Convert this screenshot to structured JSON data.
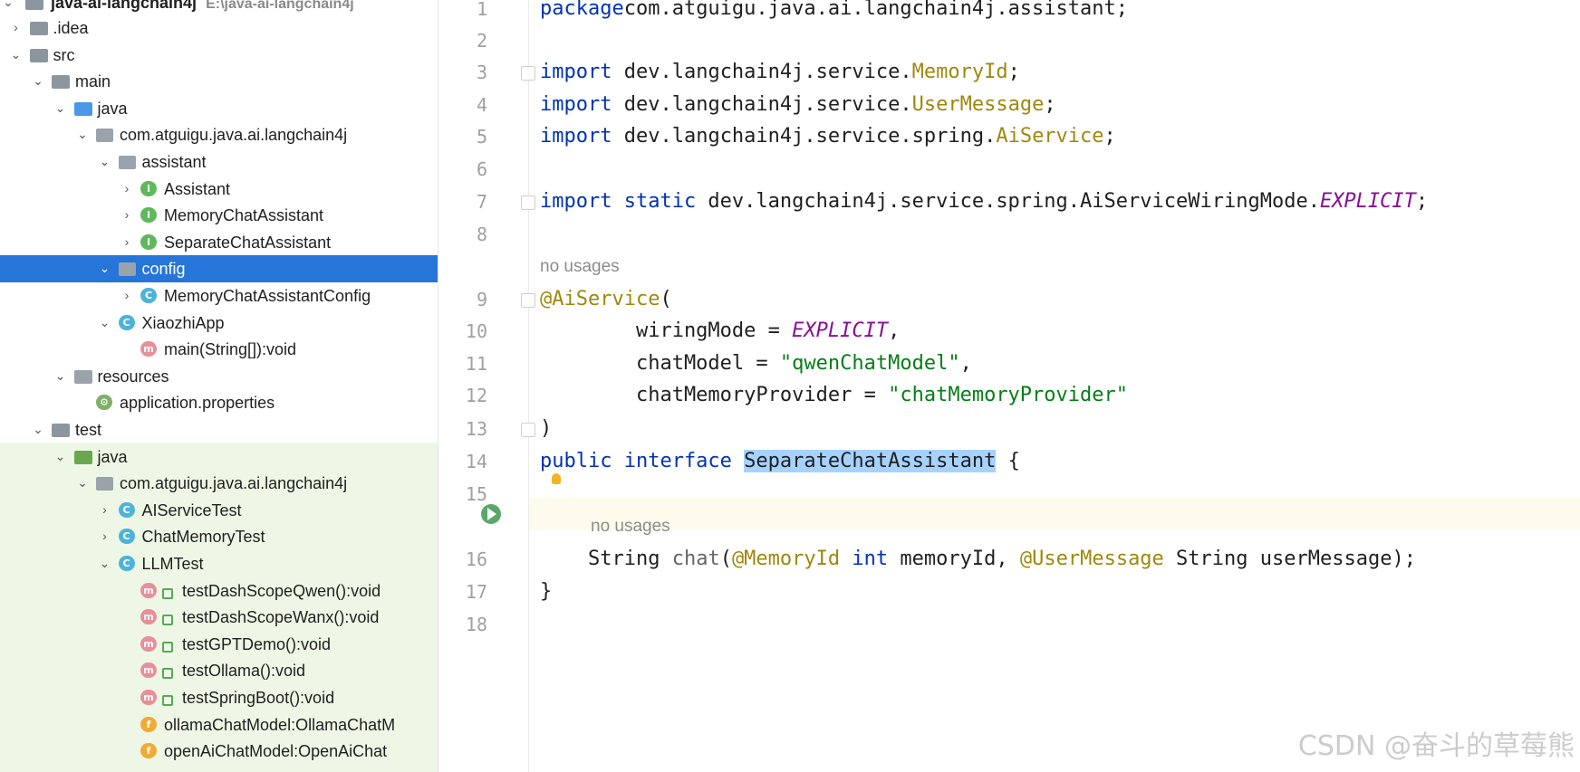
{
  "project_tree": {
    "root": {
      "label": "java-ai-langchain4j",
      "path": "E:\\java-ai-langchain4j"
    },
    "items": [
      {
        "label": ".idea",
        "type": "folder",
        "depth": 1,
        "expand": "collapsed"
      },
      {
        "label": "src",
        "type": "folder",
        "depth": 1,
        "expand": "expanded"
      },
      {
        "label": "main",
        "type": "folder",
        "depth": 2,
        "expand": "expanded"
      },
      {
        "label": "java",
        "type": "source-folder",
        "depth": 3,
        "expand": "expanded"
      },
      {
        "label": "com.atguigu.java.ai.langchain4j",
        "type": "package",
        "depth": 4,
        "expand": "expanded"
      },
      {
        "label": "assistant",
        "type": "package",
        "depth": 5,
        "expand": "expanded"
      },
      {
        "label": "Assistant",
        "type": "interface",
        "depth": 6,
        "expand": "collapsed"
      },
      {
        "label": "MemoryChatAssistant",
        "type": "interface",
        "depth": 6,
        "expand": "collapsed"
      },
      {
        "label": "SeparateChatAssistant",
        "type": "interface",
        "depth": 6,
        "expand": "collapsed"
      },
      {
        "label": "config",
        "type": "package",
        "depth": 5,
        "expand": "expanded",
        "selected": true
      },
      {
        "label": "MemoryChatAssistantConfig",
        "type": "class",
        "depth": 6,
        "expand": "collapsed"
      },
      {
        "label": "XiaozhiApp",
        "type": "class",
        "depth": 5,
        "expand": "expanded"
      },
      {
        "label": "main(String[]):void",
        "type": "method",
        "depth": 6,
        "expand": "none"
      },
      {
        "label": "resources",
        "type": "resources-folder",
        "depth": 3,
        "expand": "expanded"
      },
      {
        "label": "application.properties",
        "type": "properties",
        "depth": 4,
        "expand": "none"
      },
      {
        "label": "test",
        "type": "folder",
        "depth": 2,
        "expand": "expanded"
      },
      {
        "label": "java",
        "type": "test-folder",
        "depth": 3,
        "expand": "expanded"
      },
      {
        "label": "com.atguigu.java.ai.langchain4j",
        "type": "package",
        "depth": 4,
        "expand": "expanded"
      },
      {
        "label": "AIServiceTest",
        "type": "class",
        "depth": 5,
        "expand": "collapsed"
      },
      {
        "label": "ChatMemoryTest",
        "type": "class",
        "depth": 5,
        "expand": "collapsed"
      },
      {
        "label": "LLMTest",
        "type": "class",
        "depth": 5,
        "expand": "expanded"
      },
      {
        "label": "testDashScopeQwen():void",
        "type": "test-method",
        "depth": 6,
        "expand": "none"
      },
      {
        "label": "testDashScopeWanx():void",
        "type": "test-method",
        "depth": 6,
        "expand": "none"
      },
      {
        "label": "testGPTDemo():void",
        "type": "test-method",
        "depth": 6,
        "expand": "none"
      },
      {
        "label": "testOllama():void",
        "type": "test-method",
        "depth": 6,
        "expand": "none"
      },
      {
        "label": "testSpringBoot():void",
        "type": "test-method",
        "depth": 6,
        "expand": "none"
      },
      {
        "label": "ollamaChatModel:OllamaChatM",
        "type": "field",
        "depth": 6,
        "expand": "none"
      },
      {
        "label": "openAiChatModel:OpenAiChat",
        "type": "field",
        "depth": 6,
        "expand": "none"
      }
    ]
  },
  "editor": {
    "line_numbers": [
      "1",
      "2",
      "3",
      "4",
      "5",
      "6",
      "7",
      "8",
      "9",
      "10",
      "11",
      "12",
      "13",
      "14",
      "15",
      "16",
      "17",
      "18"
    ],
    "lines": [
      {
        "n": "1",
        "tokens": [
          [
            "kw",
            "package"
          ],
          [
            "",
            "com.atguigu.java.ai.langchain4j.assistant;"
          ]
        ]
      },
      {
        "n": "2",
        "tokens": []
      },
      {
        "n": "3",
        "tokens": [
          [
            "kw",
            "import"
          ],
          [
            "",
            " dev.langchain4j.service."
          ],
          [
            "ann",
            "MemoryId"
          ],
          [
            "",
            ";"
          ]
        ]
      },
      {
        "n": "4",
        "tokens": [
          [
            "kw",
            "import"
          ],
          [
            "",
            " dev.langchain4j.service."
          ],
          [
            "ann",
            "UserMessage"
          ],
          [
            "",
            ";"
          ]
        ]
      },
      {
        "n": "5",
        "tokens": [
          [
            "kw",
            "import"
          ],
          [
            "",
            " dev.langchain4j.service.spring."
          ],
          [
            "ann",
            "AiService"
          ],
          [
            "",
            ";"
          ]
        ]
      },
      {
        "n": "6",
        "tokens": []
      },
      {
        "n": "7",
        "tokens": [
          [
            "kw",
            "import static"
          ],
          [
            "",
            " dev.langchain4j.service.spring.AiServiceWiringMode."
          ],
          [
            "cst",
            "EXPLICIT"
          ],
          [
            "",
            ";"
          ]
        ]
      },
      {
        "n": "8",
        "tokens": []
      },
      {
        "n": "9",
        "hint": "no usages",
        "tokens": [
          [
            "ann",
            "@AiService"
          ],
          [
            "",
            "("
          ]
        ]
      },
      {
        "n": "10",
        "tokens": [
          [
            "",
            "        wiringMode = "
          ],
          [
            "cst",
            "EXPLICIT"
          ],
          [
            "",
            ","
          ]
        ]
      },
      {
        "n": "11",
        "tokens": [
          [
            "",
            "        chatModel = "
          ],
          [
            "str",
            "\"qwenChatModel\""
          ],
          [
            "",
            ","
          ]
        ]
      },
      {
        "n": "12",
        "tokens": [
          [
            "",
            "        chatMemoryProvider = "
          ],
          [
            "str",
            "\"chatMemoryProvider\""
          ]
        ]
      },
      {
        "n": "13",
        "tokens": [
          [
            "",
            ")"
          ]
        ]
      },
      {
        "n": "14",
        "tokens": [
          [
            "kw",
            "public interface"
          ],
          [
            "",
            " "
          ],
          [
            "sel",
            "SeparateChatAssistant"
          ],
          [
            "",
            " {"
          ]
        ]
      },
      {
        "n": "15",
        "tokens": []
      },
      {
        "n": "16",
        "hint": "no usages",
        "tokens": [
          [
            "",
            "    String "
          ],
          [
            "mth",
            "chat"
          ],
          [
            "",
            "("
          ],
          [
            "ann",
            "@MemoryId"
          ],
          [
            "",
            " "
          ],
          [
            "kw",
            "int"
          ],
          [
            "",
            " memoryId, "
          ],
          [
            "ann",
            "@UserMessage"
          ],
          [
            "",
            " String userMessage);"
          ]
        ]
      },
      {
        "n": "17",
        "tokens": [
          [
            "",
            "}"
          ]
        ]
      },
      {
        "n": "18",
        "tokens": []
      }
    ]
  },
  "watermark": "CSDN @奋斗的草莓熊",
  "colors": {
    "selection": "#2675d9",
    "keyword": "#0033b3",
    "annotation": "#9e880d",
    "constant": "#871094",
    "string": "#067d17"
  }
}
